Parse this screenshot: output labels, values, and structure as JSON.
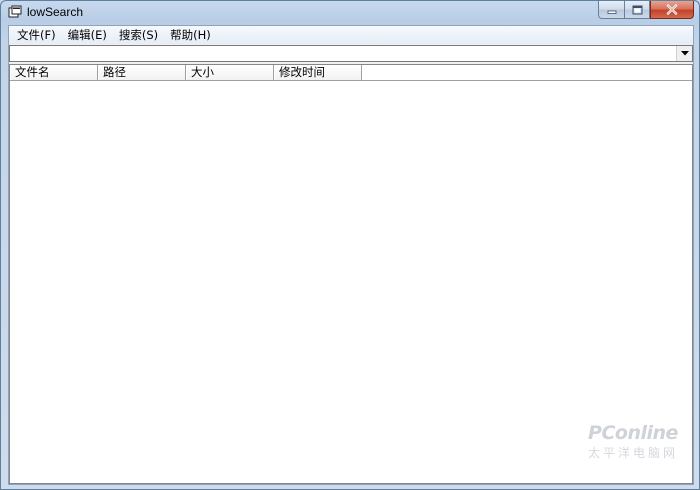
{
  "window": {
    "title": "lowSearch",
    "controls": {
      "minimize_icon": "minimize-icon",
      "maximize_icon": "maximize-icon",
      "close_icon": "close-icon"
    }
  },
  "menubar": {
    "items": [
      {
        "label": "文件(F)"
      },
      {
        "label": "编辑(E)"
      },
      {
        "label": "搜索(S)"
      },
      {
        "label": "帮助(H)"
      }
    ]
  },
  "search": {
    "value": "",
    "dropdown_icon": "chevron-down-icon"
  },
  "listview": {
    "columns": [
      {
        "label": "文件名"
      },
      {
        "label": "路径"
      },
      {
        "label": "大小"
      },
      {
        "label": "修改时间"
      }
    ],
    "rows": []
  },
  "watermark": {
    "brand": "PConline",
    "subtitle": "太平洋电脑网"
  },
  "colors": {
    "frame": "#c3d4e8",
    "close_button": "#c2432a",
    "client_background": "#ffffff"
  }
}
